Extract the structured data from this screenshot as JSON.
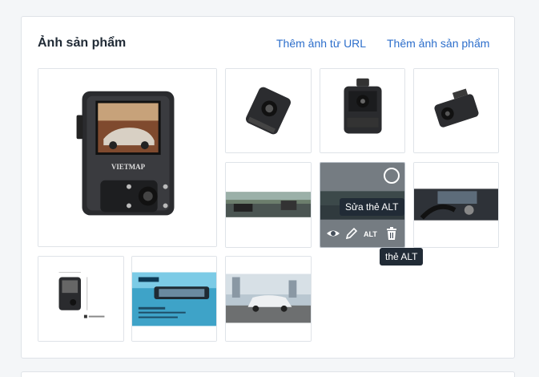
{
  "section": {
    "title": "Ảnh sản phẩm",
    "add_from_url": "Thêm ảnh từ URL",
    "add_image": "Thêm ảnh sản phẩm"
  },
  "main_image": {
    "brand_text": "VIETMAP"
  },
  "hover_actions": {
    "alt_label": "ALT",
    "edit_alt_tooltip": "Sửa thẻ ALT",
    "alt_tooltip": "thẻ ALT"
  },
  "icons": [
    "eye-icon",
    "pencil-icon",
    "trash-icon",
    "circle-check-icon"
  ],
  "colors": {
    "link": "#2c6ecb",
    "overlay": "#454f5b",
    "tooltip": "#212b36",
    "border": "#dfe3e8"
  }
}
